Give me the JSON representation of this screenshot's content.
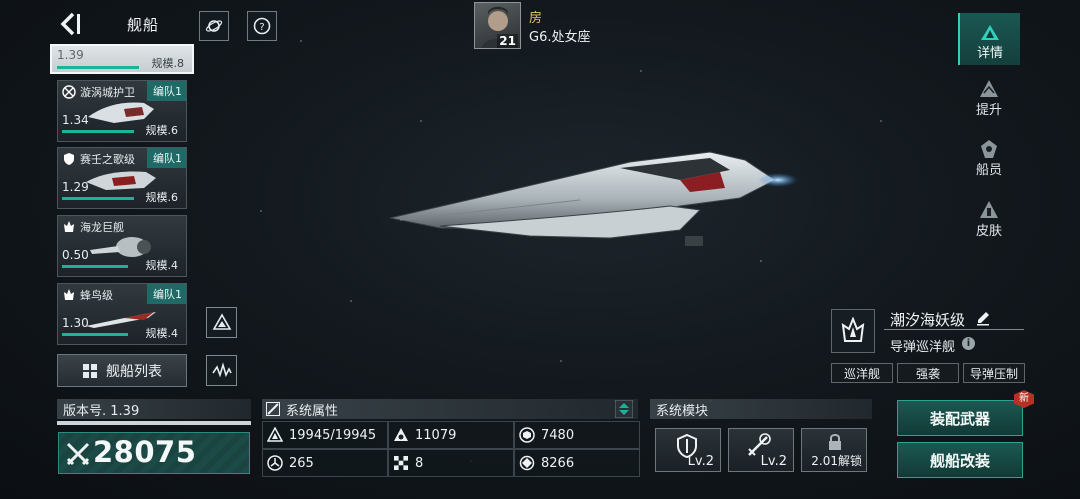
{
  "header": {
    "title": "舰船"
  },
  "player": {
    "name": "房",
    "group": "G6.处女座",
    "level": "21"
  },
  "ship_list": {
    "selected": {
      "version": "1.39",
      "scale": "规模.8"
    },
    "cards": [
      {
        "name": "漩涡城护卫",
        "badge": "编队1",
        "version": "1.34",
        "scale": "规模.6",
        "progress": 0.6
      },
      {
        "name": "赛壬之歌级",
        "badge": "编队1",
        "version": "1.29",
        "scale": "规模.6",
        "progress": 0.6
      },
      {
        "name": "海龙巨舰",
        "badge": "",
        "version": "0.50",
        "scale": "规模.4",
        "progress": 0.55
      },
      {
        "name": "蜂鸟级",
        "badge": "编队1",
        "version": "1.30",
        "scale": "规模.4",
        "progress": 0.55
      }
    ],
    "list_button": "舰船列表"
  },
  "right_tabs": [
    {
      "label": "详情",
      "icon": "ship-detail-icon",
      "active": true
    },
    {
      "label": "提升",
      "icon": "upgrade-icon",
      "active": false
    },
    {
      "label": "船员",
      "icon": "crew-icon",
      "active": false
    },
    {
      "label": "皮肤",
      "icon": "skin-icon",
      "active": false
    }
  ],
  "ship_info": {
    "class_name": "潮汐海妖级",
    "type": "导弹巡洋舰",
    "tags": [
      "巡洋舰",
      "强袭",
      "导弹压制"
    ]
  },
  "version_panel": {
    "label": "版本号. 1.39",
    "power": "28075"
  },
  "attributes_panel": {
    "title": "系统属性",
    "items": [
      {
        "icon": "hull-icon",
        "value": "19945/19945"
      },
      {
        "icon": "armor-icon",
        "value": "11079"
      },
      {
        "icon": "shield-icon",
        "value": "7480"
      },
      {
        "icon": "energy-icon",
        "value": "265"
      },
      {
        "icon": "checker-icon",
        "value": "8"
      },
      {
        "icon": "target-icon",
        "value": "8266"
      }
    ]
  },
  "modules_panel": {
    "title": "系统模块",
    "modules": [
      {
        "icon": "shield-module-icon",
        "level": "Lv.2"
      },
      {
        "icon": "weapon-module-icon",
        "level": "Lv.2"
      },
      {
        "icon": "lock-icon",
        "level": "2.01解锁"
      }
    ]
  },
  "actions": {
    "equip": "装配武器",
    "modify": "舰船改装",
    "new_badge": "新"
  },
  "colors": {
    "accent": "#19b49a",
    "active_tab": "#1f6e66",
    "gold": "#e8c26a"
  }
}
